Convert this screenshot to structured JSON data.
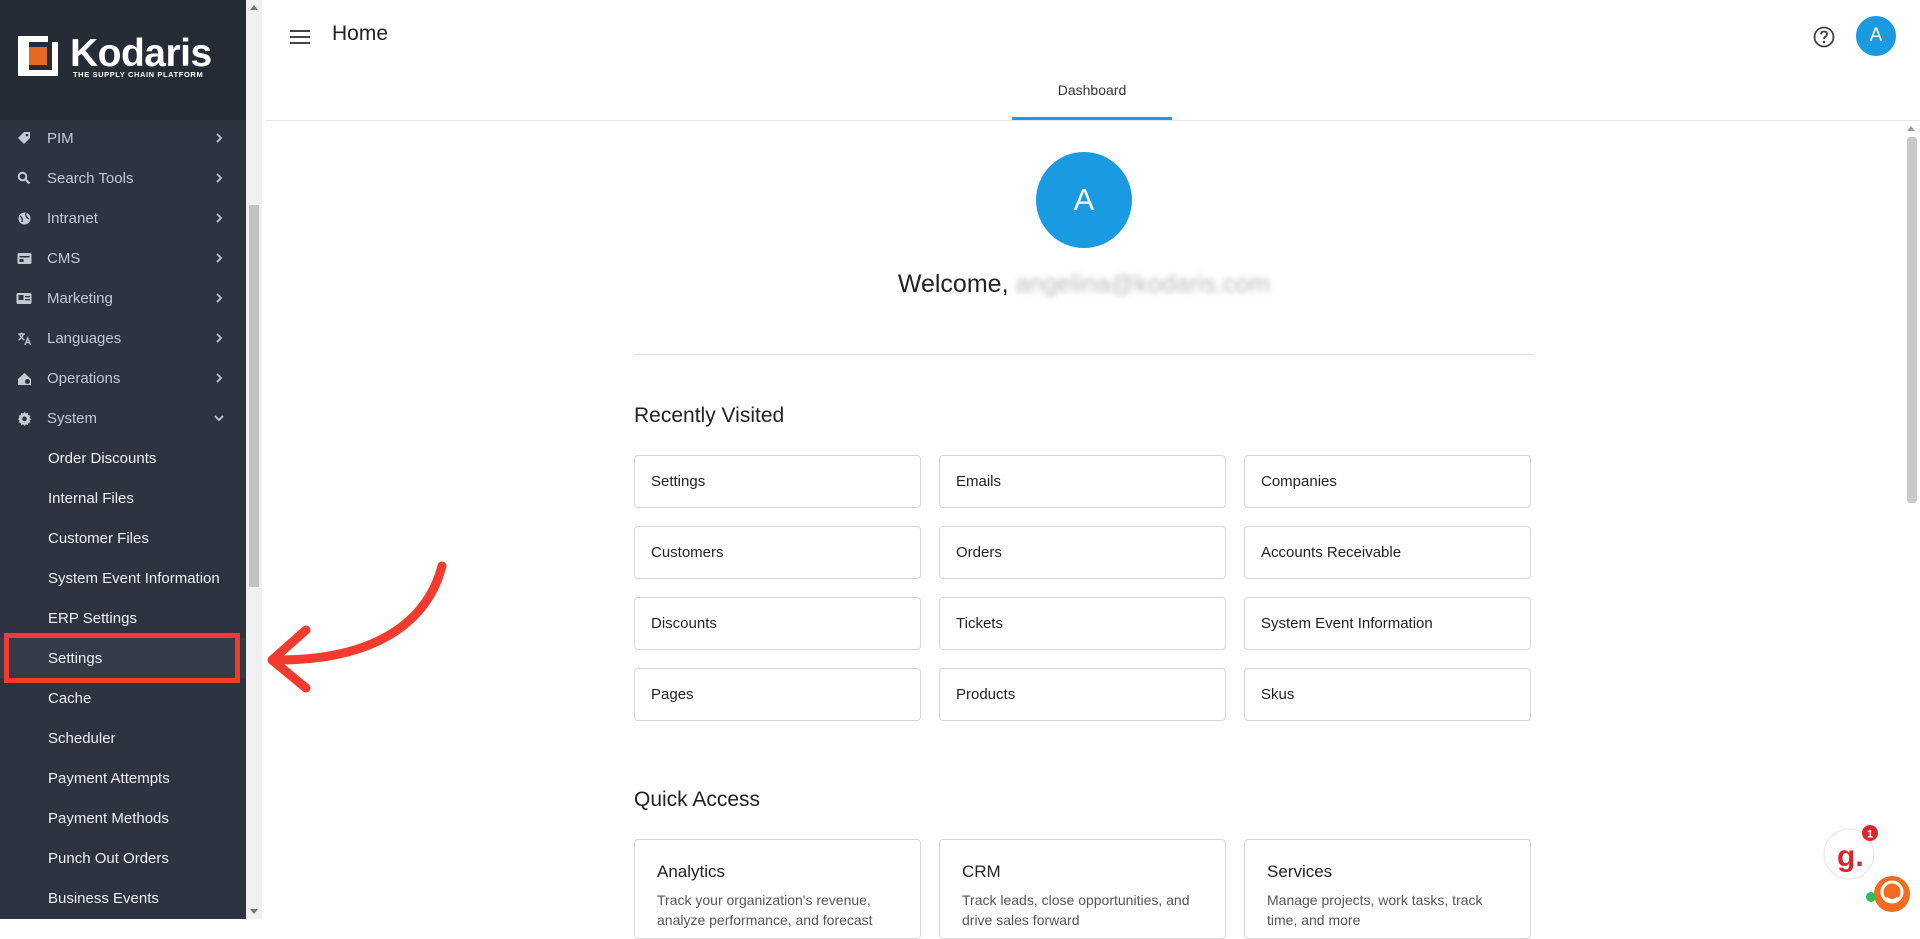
{
  "brand": {
    "name": "Kodaris",
    "tagline": "THE SUPPLY CHAIN PLATFORM",
    "accent": "#1a9ae1",
    "sidebar_bg": "#2d3440",
    "logo_orange": "#e46a24"
  },
  "sidebar": {
    "items": [
      {
        "label": "PIM",
        "icon": "tag-icon",
        "expanded": false
      },
      {
        "label": "Search Tools",
        "icon": "search-icon",
        "expanded": false
      },
      {
        "label": "Intranet",
        "icon": "globe-icon",
        "expanded": false
      },
      {
        "label": "CMS",
        "icon": "cms-card-icon",
        "expanded": false
      },
      {
        "label": "Marketing",
        "icon": "marketing-icon",
        "expanded": false
      },
      {
        "label": "Languages",
        "icon": "translate-icon",
        "expanded": false
      },
      {
        "label": "Operations",
        "icon": "operations-icon",
        "expanded": false
      },
      {
        "label": "System",
        "icon": "gear-icon",
        "expanded": true
      }
    ],
    "system_children": [
      "Order Discounts",
      "Internal Files",
      "Customer Files",
      "System Event Information",
      "ERP Settings",
      "Settings",
      "Cache",
      "Scheduler",
      "Payment Attempts",
      "Payment Methods",
      "Punch Out Orders",
      "Business Events"
    ],
    "active_child": "Settings"
  },
  "header": {
    "title": "Home",
    "avatar_initial": "A",
    "tab": "Dashboard"
  },
  "dashboard": {
    "avatar_initial": "A",
    "welcome": "Welcome,",
    "email": "angelina@kodaris.com",
    "recently_visited_title": "Recently Visited",
    "recently_visited": [
      "Settings",
      "Emails",
      "Companies",
      "Customers",
      "Orders",
      "Accounts Receivable",
      "Discounts",
      "Tickets",
      "System Event Information",
      "Pages",
      "Products",
      "Skus"
    ],
    "quick_access_title": "Quick Access",
    "quick_access": [
      {
        "title": "Analytics",
        "desc": "Track your organization's revenue, analyze performance, and forecast"
      },
      {
        "title": "CRM",
        "desc": "Track leads, close opportunities, and drive sales forward"
      },
      {
        "title": "Services",
        "desc": "Manage projects, work tasks, track time, and more"
      }
    ]
  },
  "widget": {
    "badge_count": "1",
    "logo_letter": "g."
  },
  "annotation": {
    "color": "#f23b2f"
  }
}
